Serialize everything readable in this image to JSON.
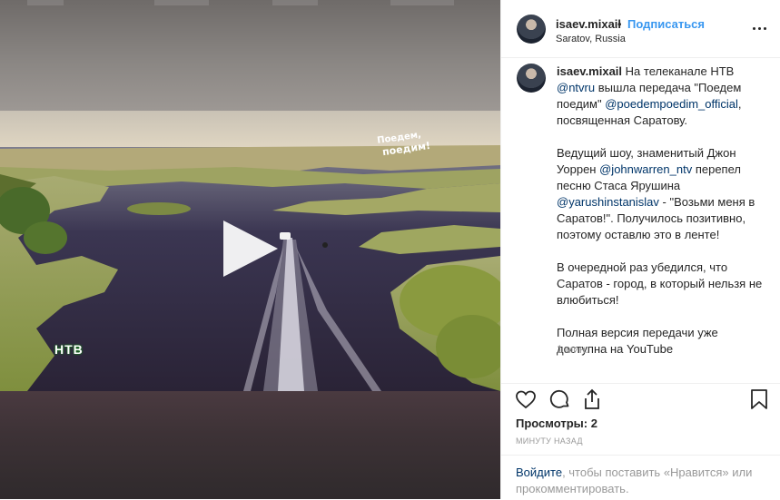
{
  "post": {
    "username": "isaev.mixail",
    "separator": "•",
    "follow_label": "Подписаться",
    "location": "Saratov, Russia"
  },
  "caption": {
    "username": "isaev.mixail",
    "text_1": " На телеканале НТВ ",
    "mention_ntvru": "@ntvru",
    "text_2": " вышла передача \"Поедем поедим\" ",
    "mention_poedem": "@poedempoedim_official",
    "text_3": ", посвященная Саратову.\n\nВедущий шоу, знаменитый Джон Уоррен ",
    "mention_john": "@johnwarren_ntv",
    "text_4": " перепел песню Стаса Ярушина ",
    "mention_yarushin": "@yarushinstanislav",
    "text_5": " - \"Возьми меня в Саратов!\". Получилось позитивно, поэтому оставлю это в ленте!\n\nВ очередной раз убедился, что Саратов - город, в который нельзя не влюбиться!\n\nПолная версия передачи уже доступна на YouTube",
    "time": "1 мин."
  },
  "stats": {
    "views_label": "Просмотры: 2",
    "ago": "МИНУТУ НАЗАД"
  },
  "login": {
    "link": "Войдите",
    "text": ", чтобы поставить «Нравится» или прокомментировать."
  },
  "media": {
    "channel_logo": "НТВ",
    "show_logo_line1": "Поедем,",
    "show_logo_line2": "поедим!"
  },
  "icons": [
    "more-icon",
    "heart-icon",
    "comment-icon",
    "share-icon",
    "bookmark-icon",
    "play-icon"
  ]
}
